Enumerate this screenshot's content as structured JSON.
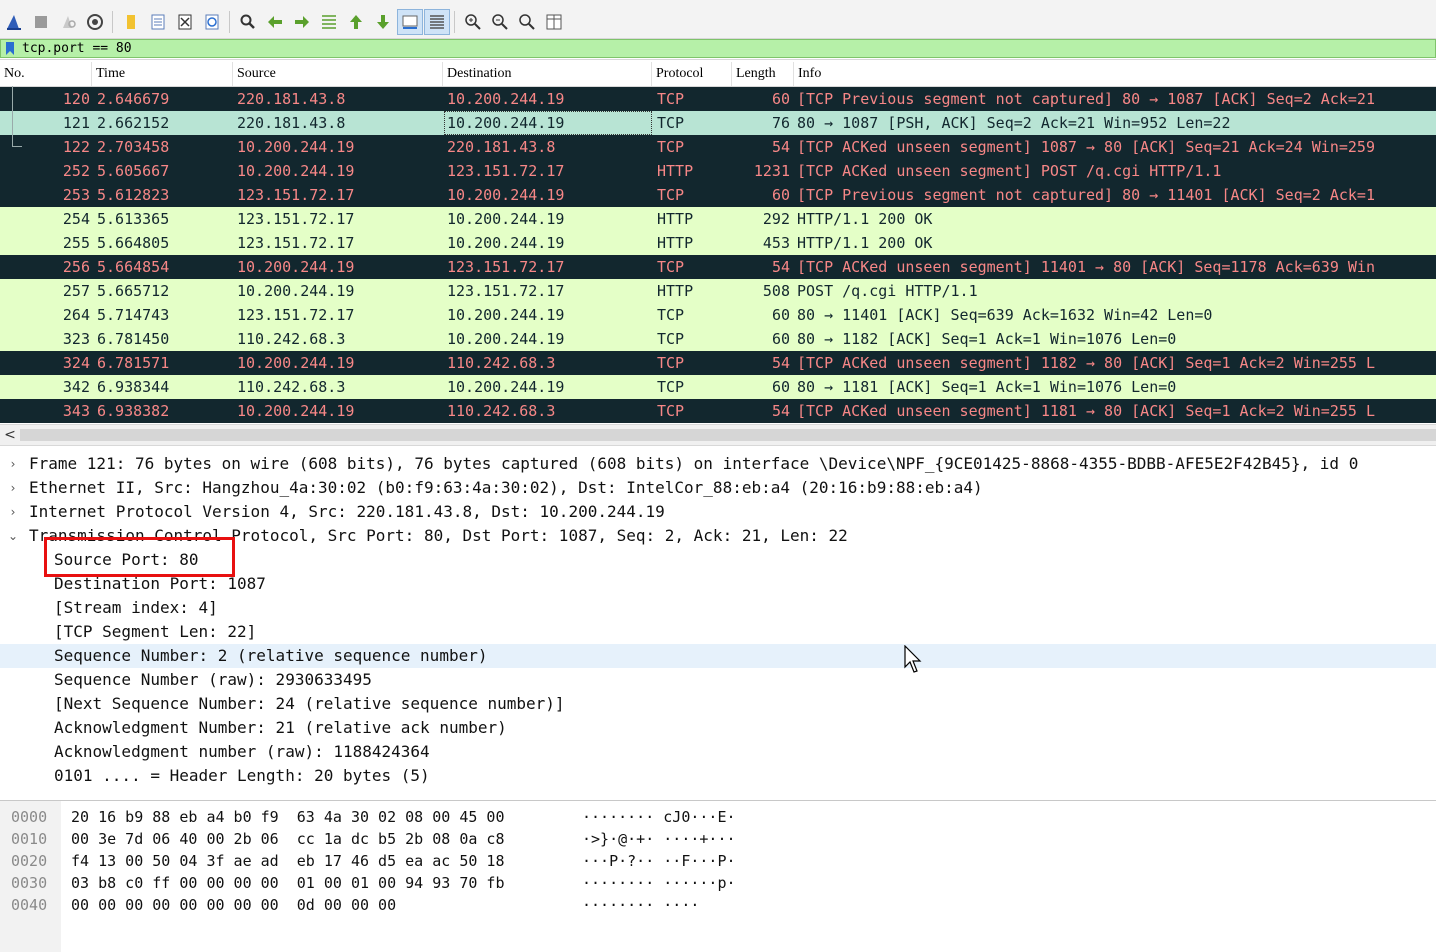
{
  "filter": {
    "text": "tcp.port == 80"
  },
  "toolbar": {
    "icons": [
      "shark-fin-start-icon",
      "stop-icon",
      "restart-icon",
      "options-gear-icon",
      "open-folder-icon",
      "save-file-icon",
      "close-file-icon",
      "reload-icon",
      "find-icon",
      "go-back-icon",
      "go-forward-icon",
      "go-to-packet-icon",
      "go-first-icon",
      "go-last-icon",
      "autoscroll-icon",
      "colorize-icon",
      "zoom-in-icon",
      "zoom-out-icon",
      "normal-size-icon",
      "resize-columns-icon"
    ]
  },
  "packet_list": {
    "columns": [
      "No.",
      "Time",
      "Source",
      "Destination",
      "Protocol",
      "Length",
      "Info"
    ],
    "rows": [
      {
        "no": "120",
        "time": "2.646679",
        "src": "220.181.43.8",
        "dst": "10.200.244.19",
        "proto": "TCP",
        "len": "60",
        "info": "[TCP Previous segment not captured] 80 → 1087 [ACK] Seq=2 Ack=21",
        "style": "dark"
      },
      {
        "no": "121",
        "time": "2.662152",
        "src": "220.181.43.8",
        "dst": "10.200.244.19",
        "proto": "TCP",
        "len": "76",
        "info": "80 → 1087 [PSH, ACK] Seq=2 Ack=21 Win=952 Len=22",
        "style": "sel"
      },
      {
        "no": "122",
        "time": "2.703458",
        "src": "10.200.244.19",
        "dst": "220.181.43.8",
        "proto": "TCP",
        "len": "54",
        "info": "[TCP ACKed unseen segment] 1087 → 80 [ACK] Seq=21 Ack=24 Win=259",
        "style": "dark"
      },
      {
        "no": "252",
        "time": "5.605667",
        "src": "10.200.244.19",
        "dst": "123.151.72.17",
        "proto": "HTTP",
        "len": "1231",
        "info": "[TCP ACKed unseen segment] POST /q.cgi HTTP/1.1",
        "style": "dark"
      },
      {
        "no": "253",
        "time": "5.612823",
        "src": "123.151.72.17",
        "dst": "10.200.244.19",
        "proto": "TCP",
        "len": "60",
        "info": "[TCP Previous segment not captured] 80 → 11401 [ACK] Seq=2 Ack=1",
        "style": "dark"
      },
      {
        "no": "254",
        "time": "5.613365",
        "src": "123.151.72.17",
        "dst": "10.200.244.19",
        "proto": "HTTP",
        "len": "292",
        "info": "HTTP/1.1 200 OK",
        "style": "green"
      },
      {
        "no": "255",
        "time": "5.664805",
        "src": "123.151.72.17",
        "dst": "10.200.244.19",
        "proto": "HTTP",
        "len": "453",
        "info": "HTTP/1.1 200 OK",
        "style": "green"
      },
      {
        "no": "256",
        "time": "5.664854",
        "src": "10.200.244.19",
        "dst": "123.151.72.17",
        "proto": "TCP",
        "len": "54",
        "info": "[TCP ACKed unseen segment] 11401 → 80 [ACK] Seq=1178 Ack=639 Win",
        "style": "dark"
      },
      {
        "no": "257",
        "time": "5.665712",
        "src": "10.200.244.19",
        "dst": "123.151.72.17",
        "proto": "HTTP",
        "len": "508",
        "info": "POST /q.cgi HTTP/1.1",
        "style": "green"
      },
      {
        "no": "264",
        "time": "5.714743",
        "src": "123.151.72.17",
        "dst": "10.200.244.19",
        "proto": "TCP",
        "len": "60",
        "info": "80 → 11401 [ACK] Seq=639 Ack=1632 Win=42 Len=0",
        "style": "green"
      },
      {
        "no": "323",
        "time": "6.781450",
        "src": "110.242.68.3",
        "dst": "10.200.244.19",
        "proto": "TCP",
        "len": "60",
        "info": "80 → 1182 [ACK] Seq=1 Ack=1 Win=1076 Len=0",
        "style": "green"
      },
      {
        "no": "324",
        "time": "6.781571",
        "src": "10.200.244.19",
        "dst": "110.242.68.3",
        "proto": "TCP",
        "len": "54",
        "info": "[TCP ACKed unseen segment] 1182 → 80 [ACK] Seq=1 Ack=2 Win=255 L",
        "style": "dark"
      },
      {
        "no": "342",
        "time": "6.938344",
        "src": "110.242.68.3",
        "dst": "10.200.244.19",
        "proto": "TCP",
        "len": "60",
        "info": "80 → 1181 [ACK] Seq=1 Ack=1 Win=1076 Len=0",
        "style": "green"
      },
      {
        "no": "343",
        "time": "6.938382",
        "src": "10.200.244.19",
        "dst": "110.242.68.3",
        "proto": "TCP",
        "len": "54",
        "info": "[TCP ACKed unseen segment] 1181 → 80 [ACK] Seq=1 Ack=2 Win=255 L",
        "style": "dark"
      }
    ]
  },
  "details": {
    "frame": "Frame 121: 76 bytes on wire (608 bits), 76 bytes captured (608 bits) on interface \\Device\\NPF_{9CE01425-8868-4355-BDBB-AFE5E2F42B45}, id 0",
    "ethernet": "Ethernet II, Src: Hangzhou_4a:30:02 (b0:f9:63:4a:30:02), Dst: IntelCor_88:eb:a4 (20:16:b9:88:eb:a4)",
    "ip": "Internet Protocol Version 4, Src: 220.181.43.8, Dst: 10.200.244.19",
    "tcp": "Transmission Control Protocol, Src Port: 80, Dst Port: 1087, Seq: 2, Ack: 21, Len: 22",
    "tcp_fields": [
      "Source Port: 80",
      "Destination Port: 1087",
      "[Stream index: 4]",
      "[TCP Segment Len: 22]",
      "Sequence Number: 2    (relative sequence number)",
      "Sequence Number (raw): 2930633495",
      "[Next Sequence Number: 24    (relative sequence number)]",
      "Acknowledgment Number: 21    (relative ack number)",
      "Acknowledgment number (raw): 1188424364",
      "0101 .... = Header Length: 20 bytes (5)"
    ],
    "expander_collapsed": "›",
    "expander_expanded": "⌄"
  },
  "bytes": {
    "rows": [
      {
        "offset": "0000",
        "hex": "20 16 b9 88 eb a4 b0 f9  63 4a 30 02 08 00 45 00",
        "ascii": "········ cJ0···E·"
      },
      {
        "offset": "0010",
        "hex": "00 3e 7d 06 40 00 2b 06  cc 1a dc b5 2b 08 0a c8",
        "ascii": "·>}·@·+· ····+···"
      },
      {
        "offset": "0020",
        "hex": "f4 13 00 50 04 3f ae ad  eb 17 46 d5 ea ac 50 18",
        "ascii": "···P·?·· ··F···P·"
      },
      {
        "offset": "0030",
        "hex": "03 b8 c0 ff 00 00 00 00  01 00 01 00 94 93 70 fb",
        "ascii": "········ ······p·"
      },
      {
        "offset": "0040",
        "hex": "00 00 00 00 00 00 00 00  0d 00 00 00",
        "ascii": "········ ····"
      }
    ]
  },
  "scroll_left": "<",
  "colors": {
    "dark_row_bg": "#12272e",
    "dark_row_fg": "#f78787",
    "green_row_bg": "#e4ffc7",
    "selected_row_bg": "#b8e4d4",
    "filter_bg": "#b6f0a8",
    "highlight_box": "#e81010"
  }
}
